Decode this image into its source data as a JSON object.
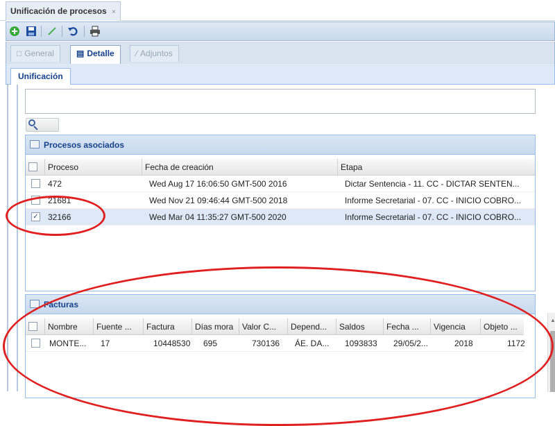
{
  "window": {
    "title": "Unificación de procesos",
    "close_glyph": "×"
  },
  "toolbar": {
    "icons": [
      "add-icon",
      "save-icon",
      "edit-icon",
      "undo-icon",
      "print-icon"
    ]
  },
  "section_tabs": [
    {
      "label": "General",
      "active": false
    },
    {
      "label": "Detalle",
      "active": true
    },
    {
      "label": "Adjuntos",
      "active": false
    }
  ],
  "inner_tab": {
    "label": "Unificación"
  },
  "procesos": {
    "title": "Procesos asociados",
    "columns": [
      "Proceso",
      "Fecha de creación",
      "Etapa"
    ],
    "rows": [
      {
        "checked": false,
        "proceso": "472",
        "fecha": "Wed Aug 17 16:06:50 GMT-500 2016",
        "etapa": "Dictar Sentencia - 11. CC - DICTAR SENTEN..."
      },
      {
        "checked": false,
        "proceso": "21681",
        "fecha": "Wed Nov 21 09:46:44 GMT-500 2018",
        "etapa": "Informe Secretarial - 07. CC - INICIO COBRO..."
      },
      {
        "checked": true,
        "proceso": "32166",
        "fecha": "Wed Mar 04 11:35:27 GMT-500 2020",
        "etapa": "Informe Secretarial - 07. CC - INICIO COBRO..."
      }
    ]
  },
  "facturas": {
    "title": "Facturas",
    "columns": [
      "Nombre",
      "Fuente ...",
      "Factura",
      "Días mora",
      "Valor C...",
      "Depend...",
      "Saldos",
      "Fecha ...",
      "Vigencia",
      "Objeto ..."
    ],
    "rows": [
      {
        "checked": false,
        "cells": [
          "MONTE...",
          "17",
          "10448530",
          "695",
          "730136",
          "ÁE. DA...",
          "1093833",
          "29/05/2...",
          "2018",
          "1172"
        ]
      }
    ]
  },
  "colors": {
    "accent": "#15428b",
    "panel_border": "#99bbe8",
    "annotation": "#e02020"
  }
}
